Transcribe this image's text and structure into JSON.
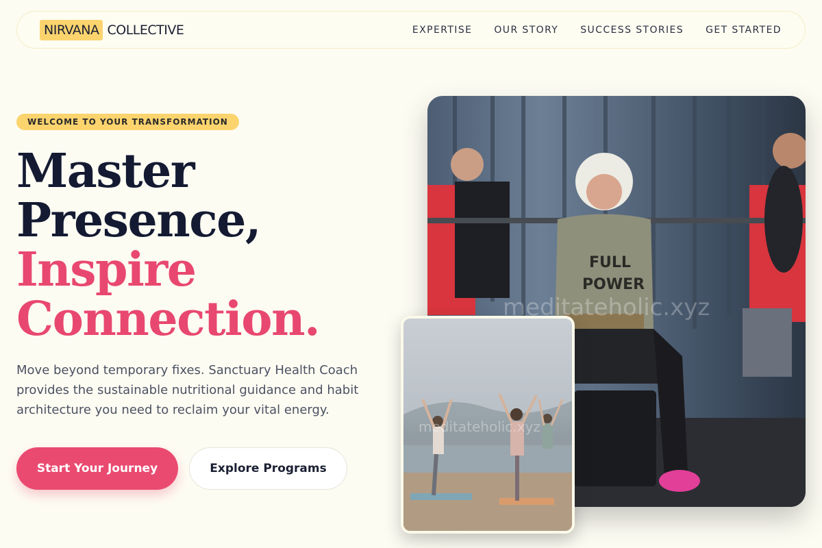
{
  "nav": {
    "brand_highlight": "NIRVANA",
    "brand_rest": "COLLECTIVE",
    "links": [
      {
        "label": "EXPERTISE"
      },
      {
        "label": "OUR STORY"
      },
      {
        "label": "SUCCESS STORIES"
      },
      {
        "label": "GET STARTED"
      }
    ]
  },
  "hero": {
    "badge": "WELCOME TO YOUR TRANSFORMATION",
    "headline_line1": "Master",
    "headline_line2": "Presence,",
    "headline_line3": "Inspire",
    "headline_line4": "Connection.",
    "description": "Move beyond temporary fixes. Sanctuary Health Coach provides the sustainable nutritional guidance and habit architecture you need to reclaim your vital energy.",
    "primary_cta": "Start Your Journey",
    "secondary_cta": "Explore Programs"
  },
  "images": {
    "main_shirt_text_1": "FULL",
    "main_shirt_text_2": "POWER",
    "watermark": "meditateholic.xyz"
  },
  "colors": {
    "background": "#fdfcf3",
    "accent_yellow": "#fcd46e",
    "accent_pink": "#ea4a70",
    "heading_dark": "#141a32"
  }
}
